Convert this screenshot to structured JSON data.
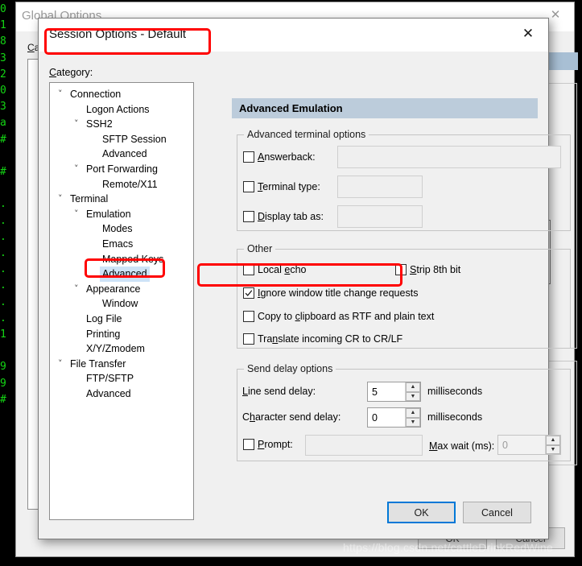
{
  "terminal": {
    "lines": "0\n1\n8\n3\n2\n0\n3\na\n#\n\n#\n\n.\n.\n.\n.\n.\n.\n.\n.\n1\n\n9\n9\n#"
  },
  "global_window": {
    "title": "Global Options",
    "category_label": "Category:",
    "close_icon": "close-icon",
    "ok_label": "OK",
    "cancel_label": "Cancel"
  },
  "session_dialog": {
    "title": "Session Options - Default",
    "close_icon": "close-icon",
    "category_label": "Category:",
    "tree": [
      {
        "label": "Connection",
        "indent": 0,
        "chevron": "v"
      },
      {
        "label": "Logon Actions",
        "indent": 1,
        "chevron": ""
      },
      {
        "label": "SSH2",
        "indent": 1,
        "chevron": "v"
      },
      {
        "label": "SFTP Session",
        "indent": 2,
        "chevron": ""
      },
      {
        "label": "Advanced",
        "indent": 2,
        "chevron": ""
      },
      {
        "label": "Port Forwarding",
        "indent": 1,
        "chevron": "v"
      },
      {
        "label": "Remote/X11",
        "indent": 2,
        "chevron": ""
      },
      {
        "label": "Terminal",
        "indent": 0,
        "chevron": "v"
      },
      {
        "label": "Emulation",
        "indent": 1,
        "chevron": "v"
      },
      {
        "label": "Modes",
        "indent": 2,
        "chevron": ""
      },
      {
        "label": "Emacs",
        "indent": 2,
        "chevron": ""
      },
      {
        "label": "Mapped Keys",
        "indent": 2,
        "chevron": ""
      },
      {
        "label": "Advanced",
        "indent": 2,
        "chevron": "",
        "selected": true
      },
      {
        "label": "Appearance",
        "indent": 1,
        "chevron": "v"
      },
      {
        "label": "Window",
        "indent": 2,
        "chevron": ""
      },
      {
        "label": "Log File",
        "indent": 1,
        "chevron": ""
      },
      {
        "label": "Printing",
        "indent": 1,
        "chevron": ""
      },
      {
        "label": "X/Y/Zmodem",
        "indent": 1,
        "chevron": ""
      },
      {
        "label": "File Transfer",
        "indent": 0,
        "chevron": "v"
      },
      {
        "label": "FTP/SFTP",
        "indent": 1,
        "chevron": ""
      },
      {
        "label": "Advanced",
        "indent": 1,
        "chevron": ""
      }
    ],
    "content": {
      "header": "Advanced Emulation",
      "group_terminal": {
        "legend": "Advanced terminal options",
        "rows": [
          {
            "label": "Answerback:",
            "checked": false,
            "value": ""
          },
          {
            "label": "Terminal type:",
            "checked": false,
            "value": ""
          },
          {
            "label": "Display tab as:",
            "checked": false,
            "value": ""
          }
        ]
      },
      "group_other": {
        "legend": "Other",
        "items": [
          {
            "label": "Local echo",
            "checked": false
          },
          {
            "label": "Strip 8th bit",
            "checked": false
          },
          {
            "label": "Ignore window title change requests",
            "checked": true
          },
          {
            "label": "Copy to clipboard as RTF and plain text",
            "checked": false
          },
          {
            "label": "Translate incoming CR to CR/LF",
            "checked": false
          }
        ]
      },
      "group_delay": {
        "legend": "Send delay options",
        "line_send_delay_label": "Line send delay:",
        "line_send_delay_value": "5",
        "line_send_delay_unit": "milliseconds",
        "char_send_delay_label": "Character send delay:",
        "char_send_delay_value": "0",
        "char_send_delay_unit": "milliseconds",
        "prompt_label": "Prompt:",
        "prompt_checked": false,
        "prompt_value": "",
        "max_wait_label": "Max wait (ms):",
        "max_wait_value": "0"
      }
    },
    "ok_label": "OK",
    "cancel_label": "Cancel"
  },
  "watermark": "https://blog.csdn.net/cattleDrinkRedWine",
  "colors": {
    "accent": "#0078d7",
    "annotation": "#ff0000",
    "header_band": "#bcccdb",
    "selection": "#cde3f7",
    "terminal_green": "#14d614"
  }
}
